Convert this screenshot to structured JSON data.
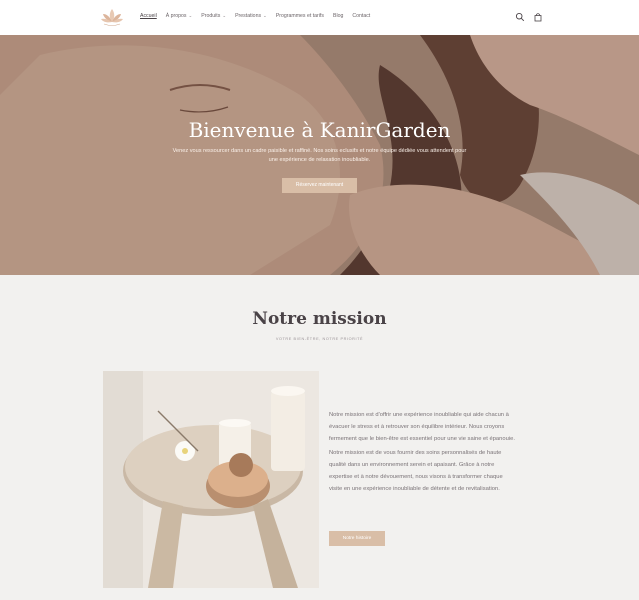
{
  "header": {
    "logo": "lotus-logo",
    "nav": [
      {
        "label": "Accueil",
        "dropdown": false,
        "active": true
      },
      {
        "label": "À propos",
        "dropdown": true,
        "active": false
      },
      {
        "label": "Produits",
        "dropdown": true,
        "active": false
      },
      {
        "label": "Prestations",
        "dropdown": true,
        "active": false
      },
      {
        "label": "Programmes et tarifs",
        "dropdown": false,
        "active": false
      },
      {
        "label": "Blog",
        "dropdown": false,
        "active": false
      },
      {
        "label": "Contact",
        "dropdown": false,
        "active": false
      }
    ],
    "icons": [
      "search-icon",
      "cart-icon"
    ]
  },
  "hero": {
    "title": "Bienvenue à KanirGarden",
    "text": "Venez vous ressourcer dans un cadre paisible et raffiné. Nos soins eclusifs et notre équipe dédiée vous attendent pour une expérience de relaxation inoubliable.",
    "button": "Réservez maintenant"
  },
  "mission": {
    "title": "Notre mission",
    "subtitle": "VOTRE BIEN-ÊTRE, NOTRE PRIORITÉ",
    "paragraph1": "Notre mission est d'offrir une expérience inoubliable qui aide chacun à évacuer le stress et à retrouver son équilibre intérieur. Nous croyons fermement que le bien-être est essentiel pour une vie saine et épanouie.",
    "paragraph2": "Notre mission est de vous fournir des soins personnalisés de haute qualité dans un environnement serein et apaisant. Grâce à notre expertise et à notre dévouement, nous visons à transformer chaque visite en une expérience inoubliable de détente et de revitalisation.",
    "button": "Notre histoire"
  },
  "colors": {
    "accent": "#d9bea7",
    "background": "#f2f1ef",
    "heading": "#4a4347"
  }
}
